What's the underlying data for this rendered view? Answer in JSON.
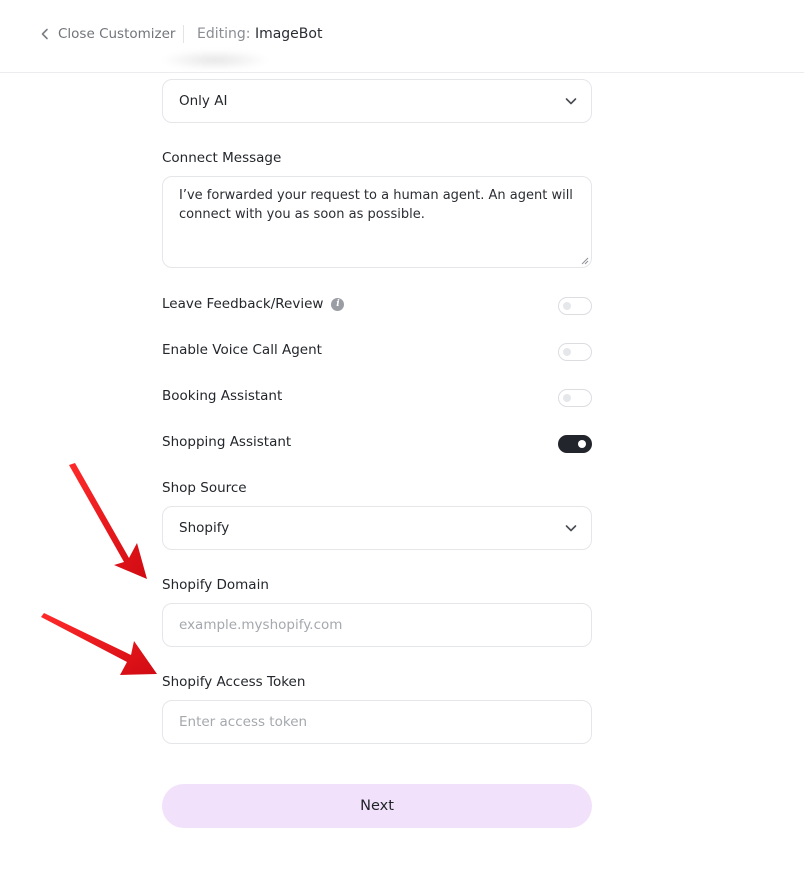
{
  "topbar": {
    "close_label": "Close Customizer",
    "editing_label": "Editing:",
    "editing_value": "ImageBot"
  },
  "form": {
    "mode_select": {
      "value": "Only AI",
      "icon": "chevron-down-icon"
    },
    "connect_message": {
      "label": "Connect Message",
      "value": "I’ve forwarded your request to a human agent. An agent will connect with you as soon as possible."
    },
    "toggles": [
      {
        "label": "Leave Feedback/Review",
        "on": false,
        "info_icon": "info-icon"
      },
      {
        "label": "Enable Voice Call Agent",
        "on": false
      },
      {
        "label": "Booking Assistant",
        "on": false
      },
      {
        "label": "Shopping Assistant",
        "on": true
      }
    ],
    "shop_source": {
      "label": "Shop Source",
      "value": "Shopify",
      "icon": "chevron-down-icon"
    },
    "shopify_domain": {
      "label": "Shopify Domain",
      "placeholder": "example.myshopify.com"
    },
    "shopify_token": {
      "label": "Shopify Access Token",
      "placeholder": "Enter access token"
    },
    "next_label": "Next"
  },
  "annotations": {
    "arrow_color": "#e8141b"
  },
  "colors": {
    "toggle_on": "#22252b",
    "next_button_bg": "#f1e1fb"
  }
}
